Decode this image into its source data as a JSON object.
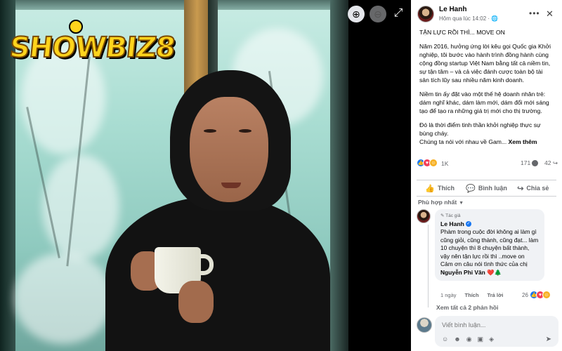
{
  "viewer": {
    "logo_text": "SHOWBIZ8",
    "zoom_in_icon": "zoom-in-icon",
    "zoom_out_icon": "zoom-out-icon",
    "expand_icon": "expand-icon"
  },
  "post": {
    "author": "Le Hanh",
    "timestamp": "Hôm qua lúc 14:02",
    "audience_icon": "globe-icon",
    "title_line": "TẬN LỰC RỒI THÌ... MOVE ON",
    "paragraphs": [
      "Năm 2016, hưởng ứng lời kêu gọi Quốc gia Khởi nghiệp, tôi bước vào hành trình đồng hành cùng cộng đồng startup Việt Nam bằng tất cả niềm tin, sự tận tâm – và cả việc đánh cược toàn bộ tài sản tích lũy sau nhiều năm kinh doanh.",
      "Niềm tin ấy đặt vào một thế hệ doanh nhân trẻ: dám nghĩ khác, dám làm mới, dám đổi mới sáng tạo để tạo ra những giá trị mới cho thị trường.",
      "Đó là thời điểm tinh thần khởi nghiệp thực sự bùng cháy."
    ],
    "last_line": "Chúng ta nói với nhau về Gam...",
    "see_more": "Xem thêm",
    "reaction_count": "1K",
    "comment_count": "171",
    "share_count": "42",
    "actions": {
      "like": "Thích",
      "comment": "Bình luận",
      "share": "Chia sẻ"
    },
    "sort_label": "Phù hợp nhất"
  },
  "comment": {
    "badge": "Tác giả",
    "author": "Le Hanh",
    "text_main": "Phàm trong cuộc đời không ai làm gì cũng giỏi, cũng thành, cũng đạt... làm 10 chuyện thì 8 chuyện bất thành, vậy nên tận lực rồi thì ..move on",
    "text_thanks": "Cảm ơn câu nói tình thức của chị",
    "mention": "Nguyễn Phi Vân",
    "emoji_tail": "❤️🌲",
    "time": "1 ngày",
    "like": "Thích",
    "reply": "Trả lời",
    "reaction_count": "26"
  },
  "replies": {
    "view_all": "Xem tất cả 2 phản hồi"
  },
  "composer": {
    "placeholder": "Viết bình luận..."
  },
  "colors": {
    "accent": "#1877f2",
    "love": "#f33e58",
    "muted": "#65676b",
    "logo_yellow": "#ffd41c"
  }
}
